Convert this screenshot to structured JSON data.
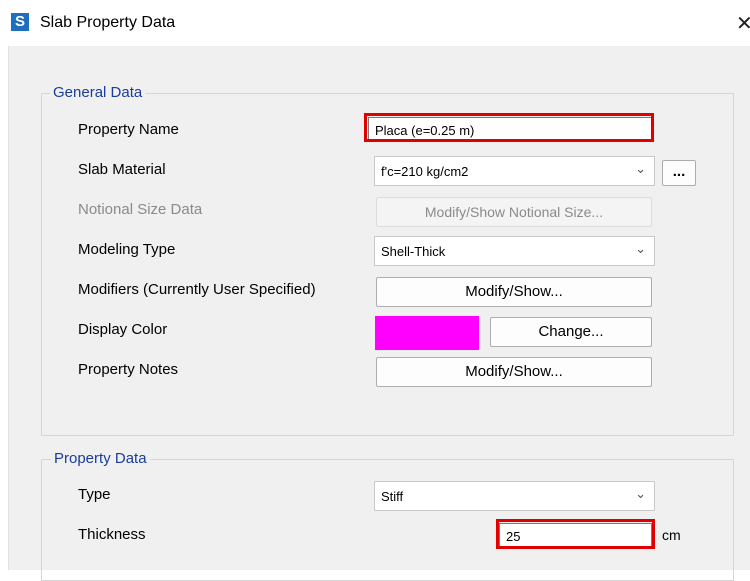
{
  "window": {
    "title": "Slab Property Data",
    "icon_letter": "S"
  },
  "general": {
    "legend": "General Data",
    "property_name": {
      "label": "Property Name",
      "value": "Placa (e=0.25 m)"
    },
    "slab_material": {
      "label": "Slab Material",
      "value": "f'c=210 kg/cm2",
      "more_label": "..."
    },
    "notional_size": {
      "label": "Notional Size Data",
      "button": "Modify/Show Notional Size..."
    },
    "modeling_type": {
      "label": "Modeling Type",
      "value": "Shell-Thick"
    },
    "modifiers": {
      "label": "Modifiers (Currently User Specified)",
      "button": "Modify/Show..."
    },
    "display_color": {
      "label": "Display Color",
      "color": "#ff00ff",
      "button": "Change..."
    },
    "property_notes": {
      "label": "Property Notes",
      "button": "Modify/Show..."
    }
  },
  "property_data": {
    "legend": "Property Data",
    "type": {
      "label": "Type",
      "value": "Stiff"
    },
    "thickness": {
      "label": "Thickness",
      "value": "25",
      "unit": "cm"
    }
  },
  "icons": {
    "close": "close-icon",
    "dropdown": "chevron-down-icon",
    "app": "app-icon"
  },
  "colors": {
    "highlight": "#e00000",
    "legend_text": "#1a3d9c"
  }
}
